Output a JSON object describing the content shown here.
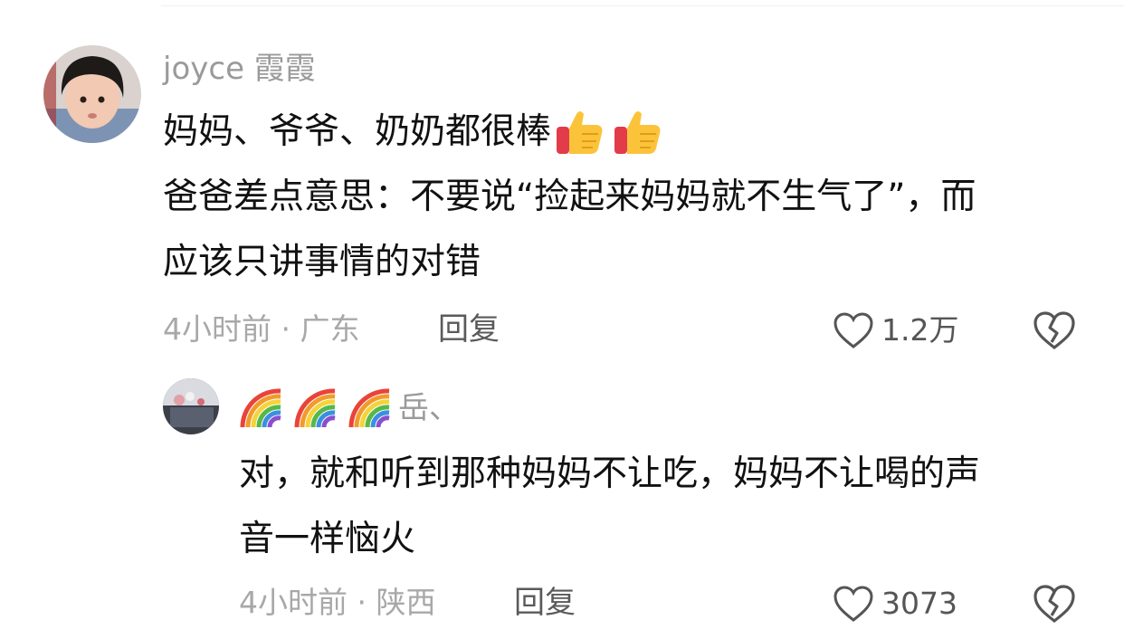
{
  "comment": {
    "username": "joyce 霞霞",
    "lines": [
      "妈妈、爷爷、奶奶都很棒",
      "爸爸差点意思：不要说“捡起来妈妈就不生气了”，而",
      "应该只讲事情的对错"
    ],
    "emoji": [
      "thumbs-up",
      "thumbs-up"
    ],
    "meta": "4小时前 · 广东",
    "reply_label": "回复",
    "like_count": "1.2万"
  },
  "reply": {
    "username_suffix": "岳、",
    "username_emoji": [
      "rainbow",
      "rainbow",
      "rainbow"
    ],
    "lines": [
      "对，就和听到那种妈妈不让吃，妈妈不让喝的声",
      "音一样恼火"
    ],
    "meta": "4小时前 · 陕西",
    "reply_label": "回复",
    "like_count": "3073"
  },
  "icons": {
    "like": "heart-outline-icon",
    "dislike": "broken-heart-icon"
  }
}
